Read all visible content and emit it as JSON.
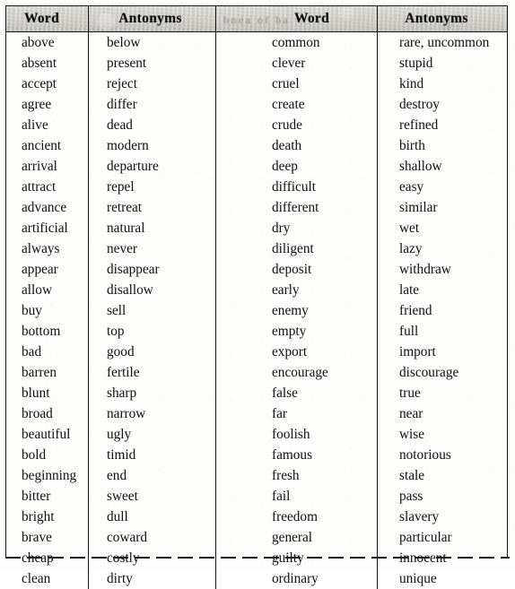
{
  "document": {
    "type": "antonyms-reference-table",
    "header_bleed_through_text": "bnea  of  ba"
  },
  "table": {
    "headers": [
      "Word",
      "Antonyms",
      "Word",
      "Antonyms"
    ],
    "left_pairs": [
      [
        "above",
        "below"
      ],
      [
        "absent",
        "present"
      ],
      [
        "accept",
        "reject"
      ],
      [
        "agree",
        "differ"
      ],
      [
        "alive",
        "dead"
      ],
      [
        "ancient",
        "modern"
      ],
      [
        "arrival",
        "departure"
      ],
      [
        "attract",
        "repel"
      ],
      [
        "advance",
        "retreat"
      ],
      [
        "artificial",
        "natural"
      ],
      [
        "always",
        "never"
      ],
      [
        "appear",
        "disappear"
      ],
      [
        "allow",
        "disallow"
      ],
      [
        "buy",
        "sell"
      ],
      [
        "bottom",
        "top"
      ],
      [
        "bad",
        "good"
      ],
      [
        "barren",
        "fertile"
      ],
      [
        "blunt",
        "sharp"
      ],
      [
        "broad",
        "narrow"
      ],
      [
        "beautiful",
        "ugly"
      ],
      [
        "bold",
        "timid"
      ],
      [
        "beginning",
        "end"
      ],
      [
        "bitter",
        "sweet"
      ],
      [
        "bright",
        "dull"
      ],
      [
        "brave",
        "coward"
      ],
      [
        "cheap",
        "costly"
      ],
      [
        "clean",
        "dirty"
      ]
    ],
    "right_pairs": [
      [
        "common",
        "rare, uncommon"
      ],
      [
        "clever",
        "stupid"
      ],
      [
        "cruel",
        "kind"
      ],
      [
        "create",
        "destroy"
      ],
      [
        "crude",
        "refined"
      ],
      [
        "death",
        "birth"
      ],
      [
        "deep",
        "shallow"
      ],
      [
        "difficult",
        "easy"
      ],
      [
        "different",
        "similar"
      ],
      [
        "dry",
        "wet"
      ],
      [
        "diligent",
        "lazy"
      ],
      [
        "deposit",
        "withdraw"
      ],
      [
        "early",
        "late"
      ],
      [
        "enemy",
        "friend"
      ],
      [
        "empty",
        "full"
      ],
      [
        "export",
        "import"
      ],
      [
        "encourage",
        "discourage"
      ],
      [
        "false",
        "true"
      ],
      [
        "far",
        "near"
      ],
      [
        "foolish",
        "wise"
      ],
      [
        "famous",
        "notorious"
      ],
      [
        "fresh",
        "stale"
      ],
      [
        "fail",
        "pass"
      ],
      [
        "freedom",
        "slavery"
      ],
      [
        "general",
        "particular"
      ],
      [
        "guilty",
        "innocent"
      ],
      [
        "ordinary",
        "unique"
      ]
    ],
    "row_count": 27,
    "colors": {
      "ink": "#0e0f12",
      "rule": "#15161a",
      "header_fill": "#cfcdc8",
      "page": "#fdfdfc"
    }
  }
}
